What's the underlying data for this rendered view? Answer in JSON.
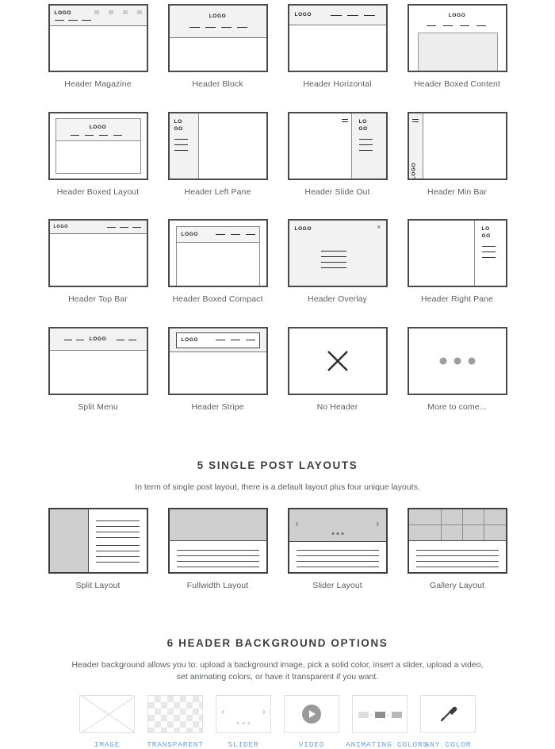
{
  "header_layouts": {
    "items": [
      {
        "label": "Header Magazine",
        "kind": "magazine"
      },
      {
        "label": "Header Block",
        "kind": "block"
      },
      {
        "label": "Header Horizontal",
        "kind": "horizontal"
      },
      {
        "label": "Header Boxed Content",
        "kind": "boxed-content"
      },
      {
        "label": "Header Boxed Layout",
        "kind": "boxed-layout"
      },
      {
        "label": "Header Left Pane",
        "kind": "left-pane"
      },
      {
        "label": "Header Slide Out",
        "kind": "slide-out"
      },
      {
        "label": "Header Min Bar",
        "kind": "min-bar"
      },
      {
        "label": "Header Top Bar",
        "kind": "top-bar"
      },
      {
        "label": "Header Boxed Compact",
        "kind": "boxed-compact"
      },
      {
        "label": "Header Overlay",
        "kind": "overlay"
      },
      {
        "label": "Header Right Pane",
        "kind": "right-pane"
      },
      {
        "label": "Split Menu",
        "kind": "split-menu"
      },
      {
        "label": "Header Stripe",
        "kind": "stripe"
      },
      {
        "label": "No Header",
        "kind": "no-header"
      },
      {
        "label": "More to come...",
        "kind": "more"
      }
    ],
    "logo_text": "LOGO",
    "close_glyph": "×"
  },
  "single_post": {
    "heading": "5 SINGLE POST LAYOUTS",
    "subheading": "In term of single post layout, there is a default layout plus four unique layouts.",
    "items": [
      {
        "label": "Split Layout",
        "kind": "split"
      },
      {
        "label": "Fullwidth Layout",
        "kind": "fullwidth"
      },
      {
        "label": "Slider Layout",
        "kind": "slider"
      },
      {
        "label": "Gallery Layout",
        "kind": "gallery"
      }
    ],
    "prev_glyph": "‹",
    "next_glyph": "›"
  },
  "background_options": {
    "heading": "6 HEADER BACKGROUND OPTIONS",
    "subheading": "Header background allows you to: upload a background image, pick a solid color, insert a slider, upload a video, set animating colors, or have it transparent if you want.",
    "items": [
      {
        "label": "IMAGE",
        "icon": "image-placeholder-icon"
      },
      {
        "label": "TRANSPARENT",
        "icon": "checkerboard-icon"
      },
      {
        "label": "SLIDER",
        "icon": "slider-arrows-icon"
      },
      {
        "label": "VIDEO",
        "icon": "play-button-icon"
      },
      {
        "label": "ANIMATING COLORS",
        "icon": "color-sequence-icon"
      },
      {
        "label": "ANY COLOR",
        "icon": "eyedropper-icon"
      }
    ],
    "prev_glyph": "‹",
    "next_glyph": "›",
    "arrow_glyph": "›"
  },
  "colors": {
    "accent_link": "#6aa3e0",
    "thumb_border": "#4a4a4a",
    "thumb_bar_bg": "#f2f2f2",
    "media_gray": "#cfcfcf",
    "text": "#5b6064",
    "heading": "#3c4043"
  }
}
